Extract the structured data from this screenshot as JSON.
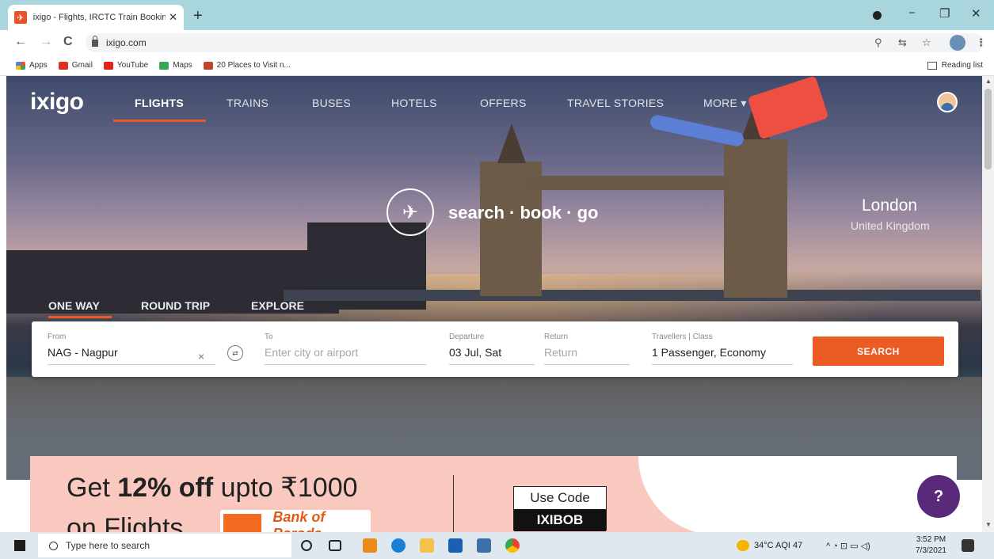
{
  "browser": {
    "tab_title": "ixigo - Flights, IRCTC Train Bookin",
    "tab_favicon": "ixigo-favicon",
    "new_tab": "+",
    "url": "ixigo.com",
    "window_controls": {
      "minimize": "−",
      "maximize": "❐",
      "close": "✕"
    },
    "nav": {
      "back": "←",
      "forward": "→",
      "reload": "C"
    },
    "toolbar_icons": {
      "location": "⚲",
      "translate": "⇆",
      "star": "☆",
      "menu": "⋮"
    }
  },
  "bookmarks": {
    "items": [
      {
        "label": "Apps",
        "color": "#e8543a"
      },
      {
        "label": "Gmail",
        "color": "#d93025"
      },
      {
        "label": "YouTube",
        "color": "#e62117"
      },
      {
        "label": "Maps",
        "color": "#34a853"
      },
      {
        "label": "20 Places to Visit n...",
        "color": "#c2442a"
      }
    ],
    "reading_list": "Reading list"
  },
  "site": {
    "logo": "ixigo",
    "nav": [
      "FLIGHTS",
      "TRAINS",
      "BUSES",
      "HOTELS",
      "OFFERS",
      "TRAVEL STORIES",
      "MORE ▾"
    ],
    "active_nav": "FLIGHTS",
    "accent_color": "#ec5b24"
  },
  "hero": {
    "tagline": "search · book · go",
    "city": "London",
    "country": "United Kingdom"
  },
  "trip_tabs": [
    "ONE WAY",
    "ROUND TRIP",
    "EXPLORE"
  ],
  "search": {
    "from_label": "From",
    "from_value": "NAG - Nagpur",
    "clear": "×",
    "to_label": "To",
    "to_placeholder": "Enter city or airport",
    "departure_label": "Departure",
    "departure_value": "03 Jul, Sat",
    "return_label": "Return",
    "return_placeholder": "Return",
    "travellers_label": "Travellers | Class",
    "travellers_value": "1 Passenger, Economy",
    "button": "SEARCH"
  },
  "promo": {
    "line1_pre": "Get ",
    "line1_bold": "12% off",
    "line1_post": " upto ₹1000",
    "line2": "on Flights",
    "bank": "Bank of Baroda",
    "code_label": "Use Code",
    "code_value": "IXIBOB"
  },
  "help_button": "?",
  "taskbar": {
    "search_placeholder": "Type here to search",
    "weather": "34°C  AQI 47",
    "time": "3:52 PM",
    "date": "7/3/2021"
  }
}
